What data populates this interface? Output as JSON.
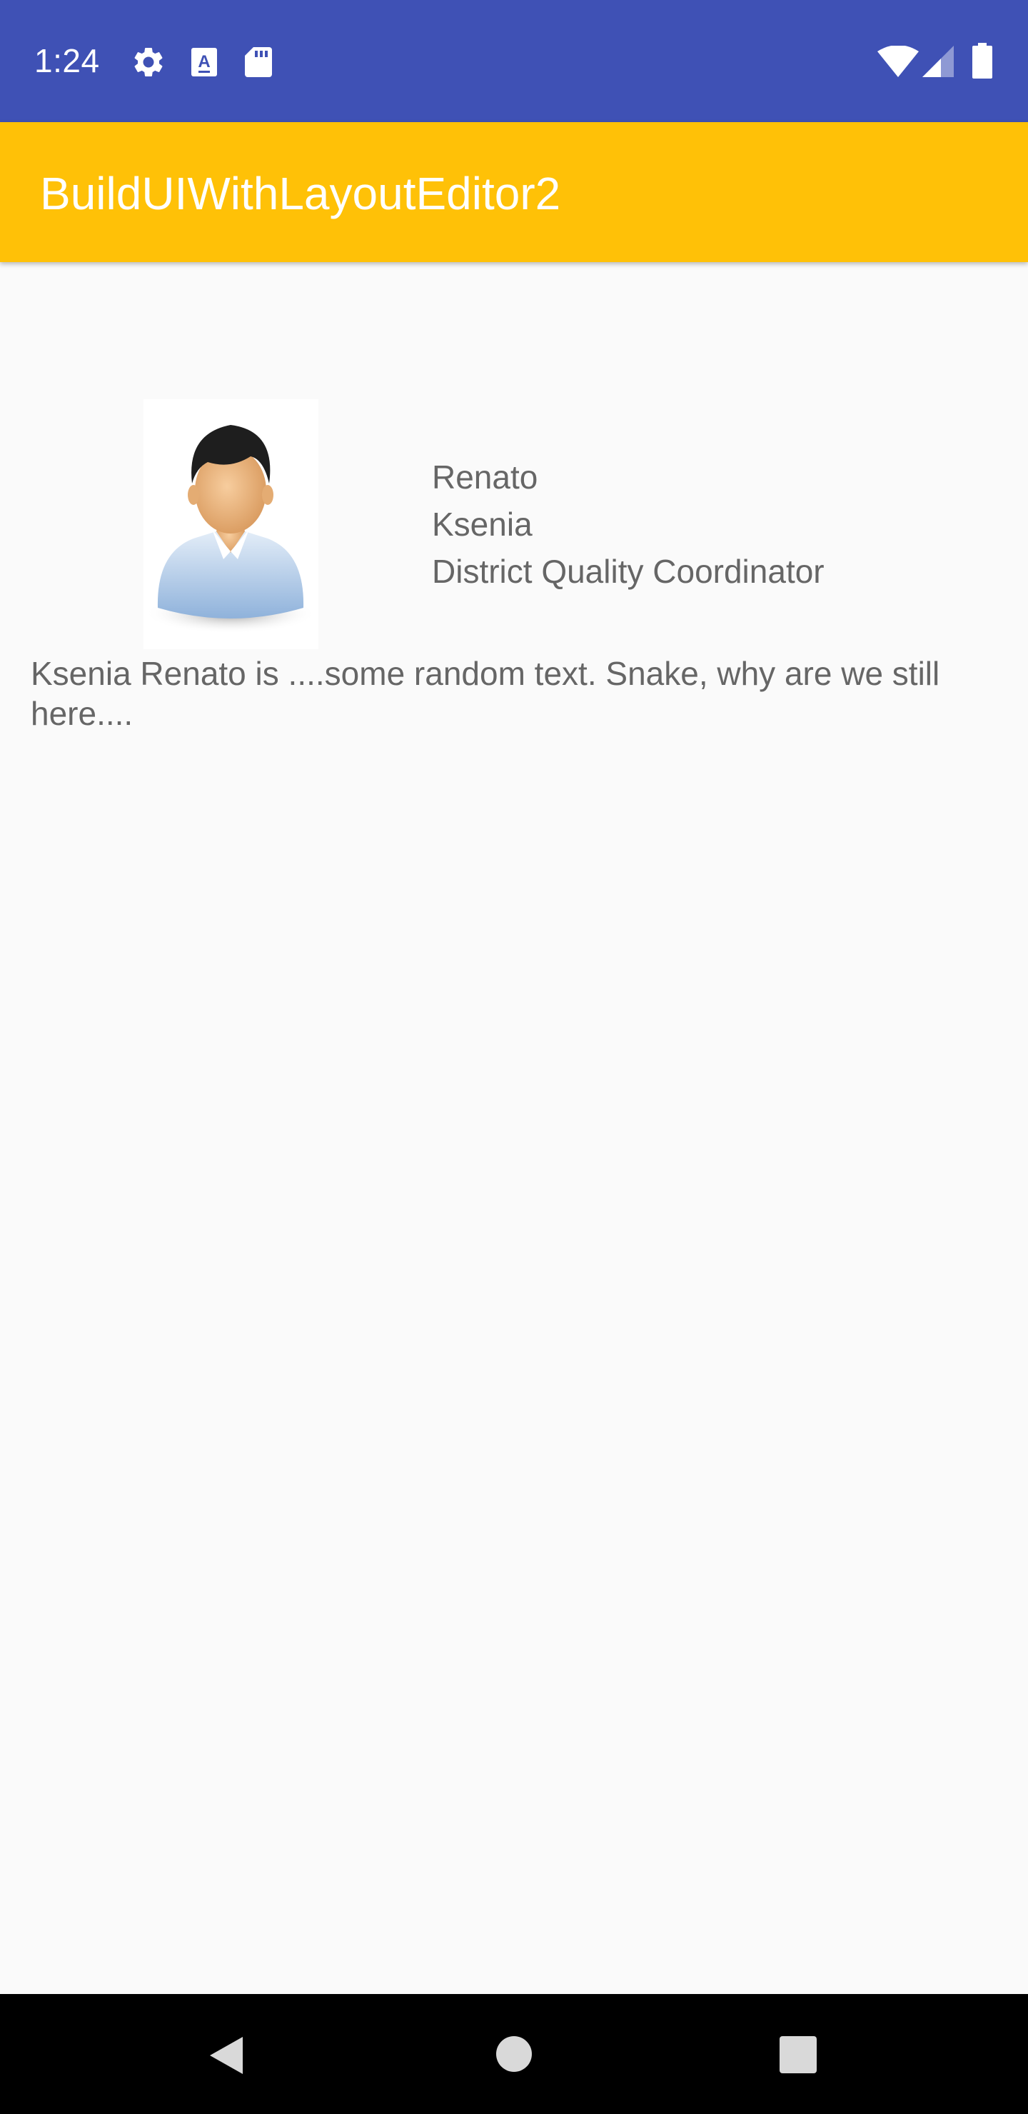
{
  "status_bar": {
    "time": "1:24",
    "icons_left": [
      "gear-icon",
      "keyboard-a-icon",
      "sd-card-icon"
    ],
    "icons_right": [
      "wifi-icon",
      "cell-signal-icon",
      "battery-icon"
    ]
  },
  "app_bar": {
    "title": "BuildUIWithLayoutEditor2"
  },
  "profile": {
    "avatar_icon": "person-avatar-icon",
    "last_name": "Renato",
    "first_name": "Ksenia",
    "job_title": "District Quality Coordinator",
    "bio": "Ksenia Renato is ....some random text. Snake, why are we still here...."
  },
  "nav_bar": {
    "buttons": [
      "back-icon",
      "home-icon",
      "recents-icon"
    ]
  },
  "colors": {
    "status_bar": "#3F51B5",
    "app_bar": "#FFC107",
    "background": "#FAFAFA",
    "text": "#666666"
  }
}
